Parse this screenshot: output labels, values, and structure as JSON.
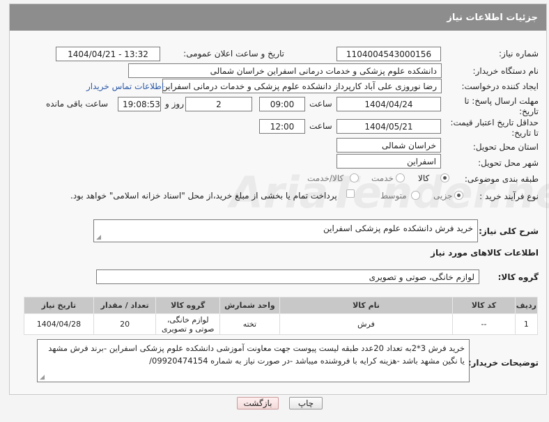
{
  "header": {
    "title": "جزئیات اطلاعات نیاز"
  },
  "form": {
    "need_number_label": "شماره نیاز:",
    "need_number": "1104004543000156",
    "announce_label": "تاریخ و ساعت اعلان عمومی:",
    "announce_value": "1404/04/21 - 13:32",
    "buyer_label": "نام دستگاه خریدار:",
    "buyer_value": "دانشکده علوم پزشکی و خدمات درمانی اسفراین خراسان شمالی",
    "creator_label": "ایجاد کننده درخواست:",
    "creator_value": "رضا نوروزی علی آباد کارپرداز  دانشکده علوم پزشکی و خدمات درمانی اسفراین خ",
    "contact_link": "اطلاعات تماس خریدار",
    "deadline_label": "مهلت ارسال پاسخ: تا تاریخ:",
    "deadline_date": "1404/04/24",
    "time_label": "ساعت",
    "deadline_time": "09:00",
    "days_value": "2",
    "days_label": "روز و",
    "remaining_time": "19:08:53",
    "remaining_label": "ساعت باقی مانده",
    "validity_label": "حداقل تاریخ اعتبار قیمت: تا تاریخ:",
    "validity_date": "1404/05/21",
    "validity_time": "12:00",
    "province_label": "استان محل تحویل:",
    "province_value": "خراسان شمالی",
    "city_label": "شهر محل تحویل:",
    "city_value": "اسفراین",
    "category_label": "طبقه بندی موضوعی:",
    "category_options": [
      "کالا",
      "خدمت",
      "کالا/خدمت"
    ],
    "process_label": "نوع فرآیند خرید :",
    "process_options": [
      "جزیی",
      "متوسط"
    ],
    "payment_note": "پرداخت تمام یا بخشی از مبلغ خرید،از محل \"اسناد خزانه اسلامی\" خواهد بود.",
    "general_desc_label": "شرح کلی نیاز:",
    "general_desc_value": "خرید فرش دانشکده علوم پزشکی اسفراین",
    "goods_info_title": "اطلاعات کالاهای مورد نیاز",
    "goods_group_label": "گروه کالا:",
    "goods_group_value": "لوازم خانگی، صوتی و تصویری"
  },
  "table": {
    "headers": [
      "ردیف",
      "کد کالا",
      "نام کالا",
      "واحد شمارش",
      "گروه کالا",
      "تعداد / مقدار",
      "تاریخ نیاز"
    ],
    "rows": [
      [
        "1",
        "--",
        "فرش",
        "تخته",
        "لوازم خانگی، صوتی و تصویری",
        "20",
        "1404/04/28"
      ]
    ]
  },
  "buyer_notes": {
    "label": "توضیحات خریدار:",
    "text": "خرید فرش 3*2به تعداد 20عدد طبقه لیست پیوست جهت معاونت آموزشی دانشکده علوم پزشکی اسفراین -برند فرش مشهد یا نگین مشهد باشد -هزینه کرایه با فروشنده میباشد -در صورت نیاز به شماره 09920474154/"
  },
  "buttons": {
    "print": "چاپ",
    "back": "بازگشت"
  },
  "watermark": "AriaTender.neT"
}
